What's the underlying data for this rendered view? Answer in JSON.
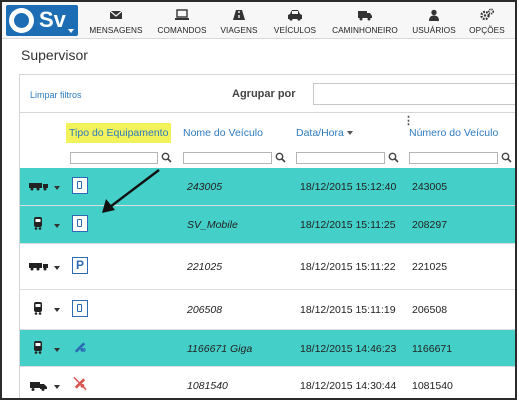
{
  "app": {
    "logo_text": "Sv",
    "nav": [
      {
        "label": "MENSAGENS",
        "icon": "envelope-icon"
      },
      {
        "label": "COMANDOS",
        "icon": "laptop-icon"
      },
      {
        "label": "VIAGENS",
        "icon": "road-icon"
      },
      {
        "label": "VEÍCULOS",
        "icon": "car-icon"
      },
      {
        "label": "CAMINHONEIRO",
        "icon": "truck-icon"
      },
      {
        "label": "USUÁRIOS",
        "icon": "user-icon"
      },
      {
        "label": "OPÇÕES",
        "icon": "gears-icon"
      }
    ]
  },
  "page": {
    "title": "Supervisor",
    "toolbar": {
      "clear_filters": "Limpar filtros",
      "group_by_label": "Agrupar por",
      "group_by_value": ""
    },
    "columns": [
      "Tipo do Equipamento",
      "Nome do Veículo",
      "Data/Hora",
      "Número do Veículo"
    ],
    "rows": [
      {
        "vehicle_icon": "truck-icon",
        "equipment_icon": "mobile-phone-icon",
        "name": "243005",
        "datetime": "18/12/2015 15:12:40",
        "number": "243005",
        "highlighted": true
      },
      {
        "vehicle_icon": "bus-icon",
        "equipment_icon": "mobile-phone-icon",
        "name": "SV_Mobile",
        "datetime": "18/12/2015 15:11:25",
        "number": "208297",
        "highlighted": true
      },
      {
        "vehicle_icon": "truck-icon",
        "equipment_icon": "parking-p-icon",
        "name": "221025",
        "datetime": "18/12/2015 15:11:22",
        "number": "221025",
        "highlighted": false
      },
      {
        "vehicle_icon": "bus-icon",
        "equipment_icon": "mobile-phone-icon",
        "name": "206508",
        "datetime": "18/12/2015 15:11:19",
        "number": "206508",
        "highlighted": false
      },
      {
        "vehicle_icon": "bus-icon",
        "equipment_icon": "satellite-icon",
        "name": "1166671 Giga",
        "datetime": "18/12/2015 14:46:23",
        "number": "1166671",
        "highlighted": true
      },
      {
        "vehicle_icon": "small-truck-icon",
        "equipment_icon": "satellite-disabled-icon",
        "name": "1081540",
        "datetime": "18/12/2015 14:30:44",
        "number": "1081540",
        "highlighted": false
      }
    ],
    "colors": {
      "highlight_row": "#44cfc8",
      "header_highlight": "#f2f25a",
      "link": "#2e7bbf",
      "brand": "#1d6db5"
    }
  }
}
